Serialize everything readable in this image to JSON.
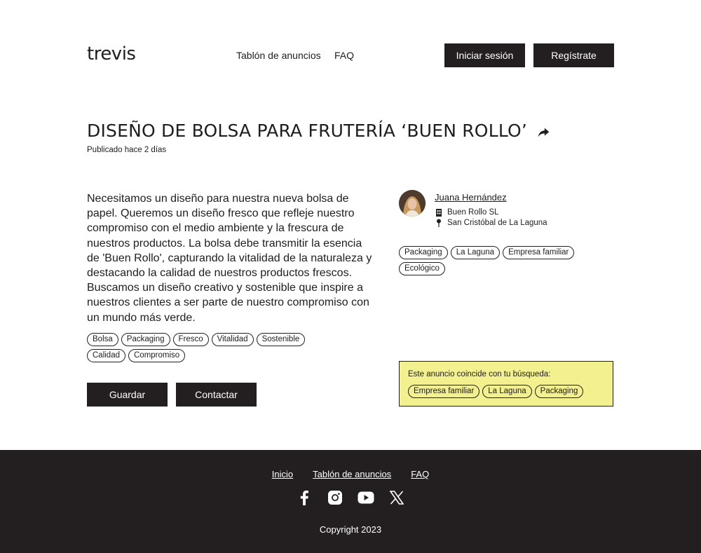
{
  "header": {
    "logo": "trevis",
    "nav": [
      {
        "label": "Tablón de anuncios"
      },
      {
        "label": "FAQ"
      }
    ],
    "login_label": "Iniciar sesión",
    "register_label": "Regístrate"
  },
  "ad": {
    "title": "DISEÑO DE BOLSA PARA FRUTERÍA ‘BUEN ROLLO’",
    "published": "Publicado hace 2 días",
    "description": "Necesitamos un diseño para nuestra nueva bolsa de papel. Queremos un diseño fresco que refleje nuestro compromiso con el medio ambiente y la frescura de nuestros productos. La bolsa debe transmitir la esencia de 'Buen Rollo', capturando la vitalidad de la naturaleza y destacando la calidad de nuestros productos frescos. Buscamos un diseño creativo y sostenible que inspire a nuestros clientes a ser parte de nuestro compromiso con un mundo más verde.",
    "tags": [
      "Bolsa",
      "Packaging",
      "Fresco",
      "Vitalidad",
      "Sostenible",
      "Calidad",
      "Compromiso"
    ],
    "save_label": "Guardar",
    "contact_label": "Contactar"
  },
  "author": {
    "name": "Juana Hernández",
    "company": "Buen Rollo SL",
    "location": "San Cristóbal de La Laguna",
    "tags": [
      "Packaging",
      "La Laguna",
      "Empresa familiar",
      "Ecológico"
    ]
  },
  "match": {
    "label": "Este anuncio coincide con tu búsqueda:",
    "tags": [
      "Empresa familiar",
      "La Laguna",
      "Packaging"
    ],
    "background": "#f2f08f"
  },
  "footer": {
    "links": [
      {
        "label": "Inicio"
      },
      {
        "label": "Tablón de anuncios"
      },
      {
        "label": "FAQ"
      }
    ],
    "socials": [
      "facebook-icon",
      "instagram-icon",
      "youtube-icon",
      "x-icon"
    ],
    "copyright": "Copyright 2023"
  },
  "colors": {
    "dark": "#231f20",
    "highlight": "#f2f08f"
  }
}
